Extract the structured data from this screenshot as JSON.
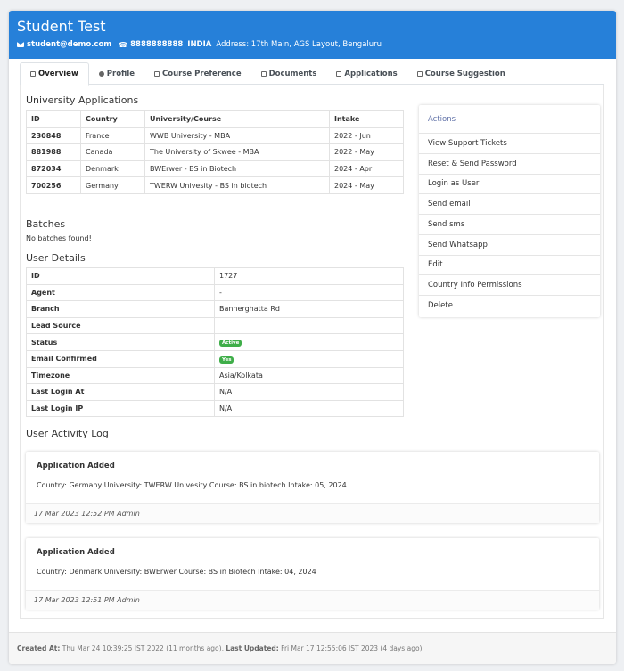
{
  "header": {
    "name": "Student Test",
    "email": "student@demo.com",
    "phone": "8888888888",
    "country": "INDIA",
    "address": "Address: 17th Main, AGS Layout, Bengaluru"
  },
  "tabs": [
    "Overview",
    "Profile",
    "Course Preference",
    "Documents",
    "Applications",
    "Course Suggestion"
  ],
  "applications": {
    "title": "University Applications",
    "columns": [
      "ID",
      "Country",
      "University/Course",
      "Intake"
    ],
    "rows": [
      [
        "230848",
        "France",
        "WWB University - MBA",
        "2022 - Jun"
      ],
      [
        "881988",
        "Canada",
        "The University of Skwee - MBA",
        "2022 - May"
      ],
      [
        "872034",
        "Denmark",
        "BWErwer - BS in Biotech",
        "2024 - Apr"
      ],
      [
        "700256",
        "Germany",
        "TWERW Univesity - BS in biotech",
        "2024 - May"
      ]
    ]
  },
  "batches": {
    "title": "Batches",
    "empty": "No batches found!"
  },
  "user_details": {
    "title": "User Details",
    "rows": [
      {
        "label": "ID",
        "value": "1727"
      },
      {
        "label": "Agent",
        "value": "-"
      },
      {
        "label": "Branch",
        "value": "Bannerghatta Rd"
      },
      {
        "label": "Lead Source",
        "value": ""
      },
      {
        "label": "Status",
        "value": "Active"
      },
      {
        "label": "Email Confirmed",
        "value": "Yes"
      },
      {
        "label": "Timezone",
        "value": "Asia/Kolkata"
      },
      {
        "label": "Last Login At",
        "value": "N/A"
      },
      {
        "label": "Last Login IP",
        "value": "N/A"
      }
    ]
  },
  "actions": {
    "title": "Actions",
    "items": [
      "View Support Tickets",
      "Reset & Send Password",
      "Login as User",
      "Send email",
      "Send sms",
      "Send Whatsapp",
      "Edit",
      "Country Info Permissions",
      "Delete"
    ]
  },
  "activity": {
    "title": "User Activity Log",
    "items": [
      {
        "title": "Application Added",
        "body": "Country: Germany University: TWERW Univesity Course: BS in biotech Intake: 05, 2024",
        "footer": "17 Mar 2023 12:52 PM Admin"
      },
      {
        "title": "Application Added",
        "body": "Country: Denmark University: BWErwer Course: BS in Biotech Intake: 04, 2024",
        "footer": "17 Mar 2023 12:51 PM Admin"
      }
    ]
  },
  "footer": {
    "created_label": "Created At:",
    "created_value": "Thu Mar 24 10:39:25 IST 2022 (11 months ago),",
    "updated_label": "Last Updated:",
    "updated_value": "Fri Mar 17 12:55:06 IST 2023 (4 days ago)"
  },
  "colors": {
    "header_bg": "#2680d9",
    "badge_green": "#3fae49",
    "actions_title": "#6172a8"
  }
}
